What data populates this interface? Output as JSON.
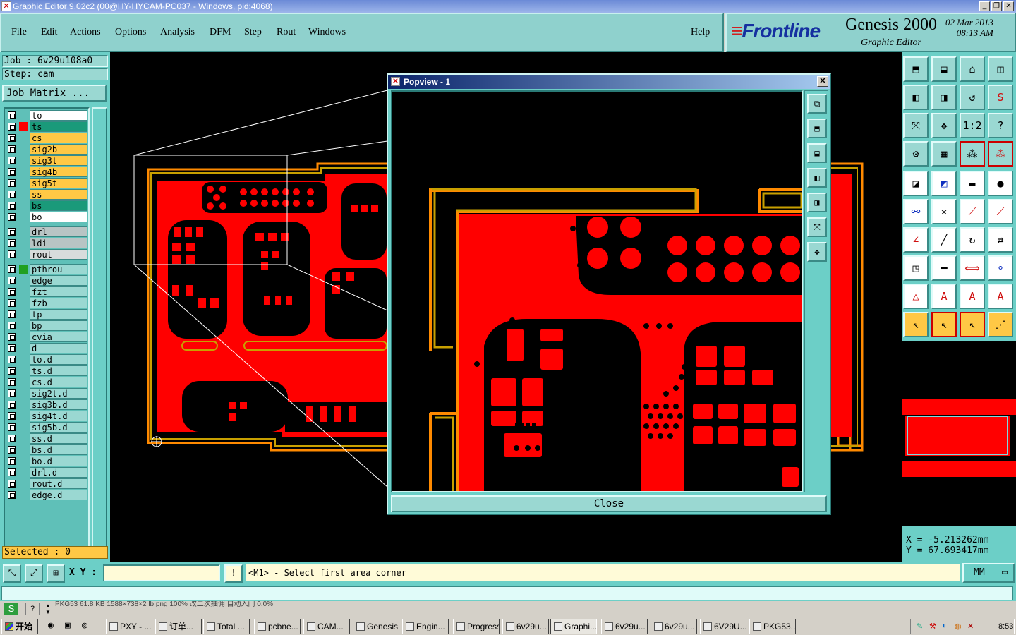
{
  "window": {
    "title": "Graphic Editor 9.02c2 (00@HY-HYCAM-PC037 - Windows, pid:4068)",
    "app_icon": "genesis-x-icon"
  },
  "menu": {
    "items": [
      "File",
      "Edit",
      "Actions",
      "Options",
      "Analysis",
      "DFM",
      "Step",
      "Rout",
      "Windows"
    ],
    "help": "Help"
  },
  "brand": {
    "logo": "Frontline",
    "product": "Genesis 2000",
    "subtitle": "Graphic Editor",
    "date": "02 Mar 2013",
    "time": "08:13 AM"
  },
  "job": {
    "job_label": "Job : 6v29u108a0",
    "step_label": "Step: cam",
    "matrix_button": "Job Matrix ..."
  },
  "layers": [
    {
      "name": "to",
      "color": "#ffffff",
      "swatch": "",
      "group": 1
    },
    {
      "name": "ts",
      "color": "#1a9a7a",
      "swatch": "#ff0000",
      "group": 1
    },
    {
      "name": "cs",
      "color": "#ffc845",
      "swatch": "",
      "group": 1
    },
    {
      "name": "sig2b",
      "color": "#ffc845",
      "swatch": "",
      "group": 1
    },
    {
      "name": "sig3t",
      "color": "#ffc845",
      "swatch": "",
      "group": 1
    },
    {
      "name": "sig4b",
      "color": "#ffc845",
      "swatch": "",
      "group": 1
    },
    {
      "name": "sig5t",
      "color": "#ffc845",
      "swatch": "",
      "group": 1
    },
    {
      "name": "ss",
      "color": "#ffc845",
      "swatch": "",
      "group": 1
    },
    {
      "name": "bs",
      "color": "#1a9a7a",
      "swatch": "",
      "group": 1
    },
    {
      "name": "bo",
      "color": "#ffffff",
      "swatch": "",
      "group": 1
    },
    {
      "name": "drl",
      "color": "#b8c4c4",
      "swatch": "",
      "group": 2
    },
    {
      "name": "ldi",
      "color": "#b8c4c4",
      "swatch": "",
      "group": 2
    },
    {
      "name": "rout",
      "color": "#d8dcdc",
      "swatch": "",
      "group": 2
    },
    {
      "name": "pthrou",
      "color": "#9ad8d2",
      "swatch": "#20a020",
      "group": 3
    },
    {
      "name": "edge",
      "color": "#9ad8d2",
      "swatch": "",
      "group": 3
    },
    {
      "name": "fzt",
      "color": "#9ad8d2",
      "swatch": "",
      "group": 3
    },
    {
      "name": "fzb",
      "color": "#9ad8d2",
      "swatch": "",
      "group": 3
    },
    {
      "name": "tp",
      "color": "#9ad8d2",
      "swatch": "",
      "group": 3
    },
    {
      "name": "bp",
      "color": "#9ad8d2",
      "swatch": "",
      "group": 3
    },
    {
      "name": "cvia",
      "color": "#9ad8d2",
      "swatch": "",
      "group": 3
    },
    {
      "name": "d",
      "color": "#9ad8d2",
      "swatch": "",
      "group": 3
    },
    {
      "name": "to.d",
      "color": "#9ad8d2",
      "swatch": "",
      "group": 3
    },
    {
      "name": "ts.d",
      "color": "#9ad8d2",
      "swatch": "",
      "group": 3
    },
    {
      "name": "cs.d",
      "color": "#9ad8d2",
      "swatch": "",
      "group": 3
    },
    {
      "name": "sig2t.d",
      "color": "#9ad8d2",
      "swatch": "",
      "group": 3
    },
    {
      "name": "sig3b.d",
      "color": "#9ad8d2",
      "swatch": "",
      "group": 3
    },
    {
      "name": "sig4t.d",
      "color": "#9ad8d2",
      "swatch": "",
      "group": 3
    },
    {
      "name": "sig5b.d",
      "color": "#9ad8d2",
      "swatch": "",
      "group": 3
    },
    {
      "name": "ss.d",
      "color": "#9ad8d2",
      "swatch": "",
      "group": 3
    },
    {
      "name": "bs.d",
      "color": "#9ad8d2",
      "swatch": "",
      "group": 3
    },
    {
      "name": "bo.d",
      "color": "#9ad8d2",
      "swatch": "",
      "group": 3
    },
    {
      "name": "drl.d",
      "color": "#9ad8d2",
      "swatch": "",
      "group": 3
    },
    {
      "name": "rout.d",
      "color": "#9ad8d2",
      "swatch": "",
      "group": 3
    },
    {
      "name": "edge.d",
      "color": "#9ad8d2",
      "swatch": "",
      "group": 3
    }
  ],
  "selected": "Selected : 0",
  "popview": {
    "title": "Popview - 1",
    "close": "Close",
    "close_x": "✕"
  },
  "toolbox": {
    "rows": [
      [
        "home-up-icon",
        "home-down-icon",
        "home-icon",
        "window-split-icon"
      ],
      [
        "pan-left-icon",
        "pan-right-icon",
        "zoom-back-icon",
        "redraw-icon"
      ],
      [
        "zoom-fit-icon",
        "zoom-center-icon",
        "scale-1-2-icon",
        "help-query-icon"
      ],
      [
        "measure-tool-icon",
        "grid-icon",
        "snap-net-icon",
        "snap-net-red-icon"
      ],
      [
        "add-pad-icon",
        "add-line-red-icon",
        "ruler-icon",
        "round-pad-icon"
      ],
      [
        "node-connect-icon",
        "cross-snap-icon",
        "line-point-icon",
        "arc-point-icon"
      ],
      [
        "angle-icon",
        "slash-line-icon",
        "arc-cw-icon",
        "flip-icon"
      ],
      [
        "square-point-icon",
        "midpoint-icon",
        "dimension-icon",
        "pads-icon"
      ],
      [
        "triangle-a-icon",
        "triangle-b-icon",
        "triangle-c-icon",
        "triangle-d-icon"
      ],
      [
        "select-arrow-icon",
        "select-arrow-box-icon",
        "select-arrow-yellow-icon",
        "node-edit-icon"
      ]
    ],
    "scale_label": "1:2",
    "query_label": "?"
  },
  "coords": {
    "x": "X  =  -5.213262mm",
    "y": "Y  =  67.693417mm"
  },
  "command": {
    "xy_label": "X Y :",
    "xy_value": "",
    "prompt": "<M1> - Select first area corner",
    "units": "MM"
  },
  "status_strip": {
    "text": "PKG53 61.8 KB  1588×738×2 lb png  100%  改二次抽佣    自动入门  0.0%"
  },
  "taskbar": {
    "start": "开始",
    "tasks": [
      "PXY - ...",
      "订单...",
      "Total ...",
      "pcbne...",
      "CAM...",
      "Genesis",
      "Engin...",
      "Progress",
      "6v29u...",
      "Graphi...",
      "6v29u...",
      "6v29u...",
      "6V29U...",
      "PKG53..."
    ],
    "active": "Graphi...",
    "clock": "8:53"
  }
}
